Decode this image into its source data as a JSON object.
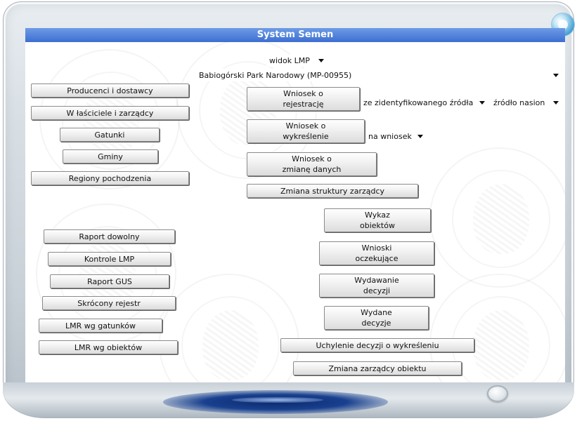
{
  "app": {
    "title": "System Semen"
  },
  "top": {
    "view_select": "widok LMP",
    "park_select": "Babiogórski Park Narodowy (MP-00955)"
  },
  "left_menu": {
    "producenci": "Producenci i dostawcy",
    "wlasciciele": "W łaściciele i zarządcy",
    "gatunki": "Gatunki",
    "gminy": "Gminy",
    "regiony": "Regiony pochodzenia",
    "raport_dowolny": "Raport dowolny",
    "kontrole": "Kontrole LMP",
    "raport_gus": "Raport GUS",
    "skrocony": "Skrócony rejestr",
    "lmr_gatunki": "LMR wg gatunków",
    "lmr_obiekty": "LMR wg obiektów"
  },
  "wnioski": {
    "rejestracja_line1": "Wniosek o",
    "rejestracja_line2": "rejestrację",
    "zrodlo_select": "ze zidentyfikowanego źródła",
    "rodzaj_select": "źródło nasion",
    "wykreslenie_line1": "Wniosek o",
    "wykreslenie_line2": "wykreślenie",
    "na_wniosek_select": "na wniosek",
    "zmiana_line1": "Wniosek o",
    "zmiana_line2": "zmianę danych",
    "struktura": "Zmiana struktury zarządcy"
  },
  "right_menu": {
    "wykaz_line1": "Wykaz",
    "wykaz_line2": "obiektów",
    "oczekujace_line1": "Wnioski",
    "oczekujace_line2": "oczekujące",
    "wydawanie_line1": "Wydawanie",
    "wydawanie_line2": "decyzji",
    "wydane_line1": "Wydane",
    "wydane_line2": "decyzje",
    "uchylenie": "Uchylenie decyzji o wykreśleniu",
    "zmiana_zarzadcy": "Zmiana zarządcy obiektu"
  },
  "colors": {
    "title_bar": "#3d6fd2",
    "title_text": "#ffffff",
    "bezel": "#d7dee4",
    "accent_stripe": "#19408f"
  }
}
